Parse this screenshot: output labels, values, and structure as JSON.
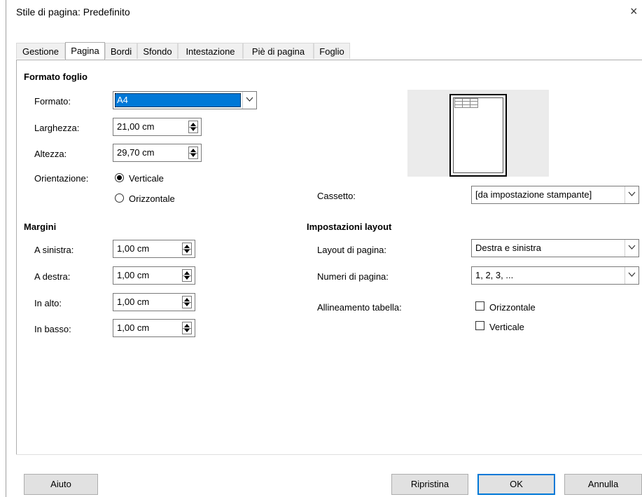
{
  "dialog": {
    "title": "Stile di pagina: Predefinito",
    "close_glyph": "×"
  },
  "tabs": [
    {
      "label": "Gestione",
      "active": false
    },
    {
      "label": "Pagina",
      "active": true
    },
    {
      "label": "Bordi",
      "active": false
    },
    {
      "label": "Sfondo",
      "active": false
    },
    {
      "label": "Intestazione",
      "active": false
    },
    {
      "label": "Piè di pagina",
      "active": false
    },
    {
      "label": "Foglio",
      "active": false
    }
  ],
  "paper_format": {
    "heading": "Formato foglio",
    "format_label": "Formato:",
    "format_value": "A4",
    "width_label": "Larghezza:",
    "width_value": "21,00 cm",
    "height_label": "Altezza:",
    "height_value": "29,70 cm",
    "orientation_label": "Orientazione:",
    "orientation_options": [
      {
        "label": "Verticale",
        "selected": true
      },
      {
        "label": "Orizzontale",
        "selected": false
      }
    ],
    "tray_label": "Cassetto:",
    "tray_value": "[da impostazione stampante]"
  },
  "margins": {
    "heading": "Margini",
    "left_label": "A sinistra:",
    "left_value": "1,00 cm",
    "right_label": "A destra:",
    "right_value": "1,00 cm",
    "top_label": "In alto:",
    "top_value": "1,00 cm",
    "bottom_label": "In basso:",
    "bottom_value": "1,00 cm"
  },
  "layout": {
    "heading": "Impostazioni layout",
    "page_layout_label": "Layout di pagina:",
    "page_layout_value": "Destra e sinistra",
    "page_numbers_label": "Numeri di pagina:",
    "page_numbers_value": "1, 2, 3, ...",
    "table_alignment_label": "Allineamento tabella:",
    "horizontal_label": "Orizzontale",
    "horizontal_checked": false,
    "vertical_label": "Verticale",
    "vertical_checked": false
  },
  "buttons": {
    "help": "Aiuto",
    "reset": "Ripristina",
    "ok": "OK",
    "cancel": "Annulla"
  },
  "colors": {
    "accent": "#0078d7",
    "preview_bg": "#ebebeb"
  }
}
